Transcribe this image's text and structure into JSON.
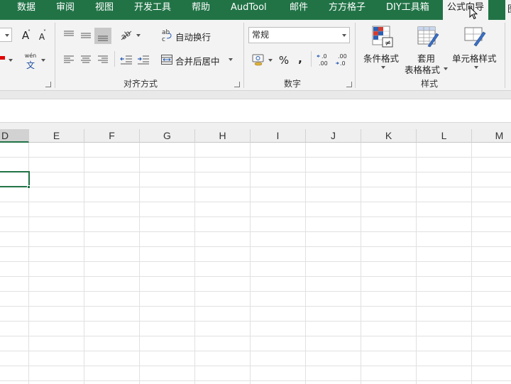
{
  "tabs": [
    {
      "label": "数据"
    },
    {
      "label": "审阅"
    },
    {
      "label": "视图"
    },
    {
      "label": "开发工具"
    },
    {
      "label": "帮助"
    },
    {
      "label": "AudTool"
    },
    {
      "label": "邮件"
    },
    {
      "label": "方方格子"
    },
    {
      "label": "DIY工具箱"
    },
    {
      "label": "公式向导",
      "active": true
    },
    {
      "label": "图"
    }
  ],
  "font_group": {
    "grow_label": "A",
    "shrink_label": "A",
    "phonetic_label": "wén",
    "phonetic_char": "文"
  },
  "alignment_group": {
    "wrap_text": "自动换行",
    "merge_center": "合并后居中",
    "group_label": "对齐方式"
  },
  "number_group": {
    "format_value": "常规",
    "percent": "%",
    "comma": ",",
    "group_label": "数字"
  },
  "styles_group": {
    "conditional_format": "条件格式",
    "table_format_line1": "套用",
    "table_format_line2": "表格格式",
    "cell_styles": "单元格样式",
    "group_label": "样式"
  },
  "columns": [
    "D",
    "E",
    "F",
    "G",
    "H",
    "I",
    "J",
    "K",
    "L",
    "M"
  ],
  "selected_column": "D",
  "colors": {
    "excel_green": "#217346",
    "ribbon_bg": "#f3f3f3",
    "grid_line": "#e1e1e1"
  }
}
